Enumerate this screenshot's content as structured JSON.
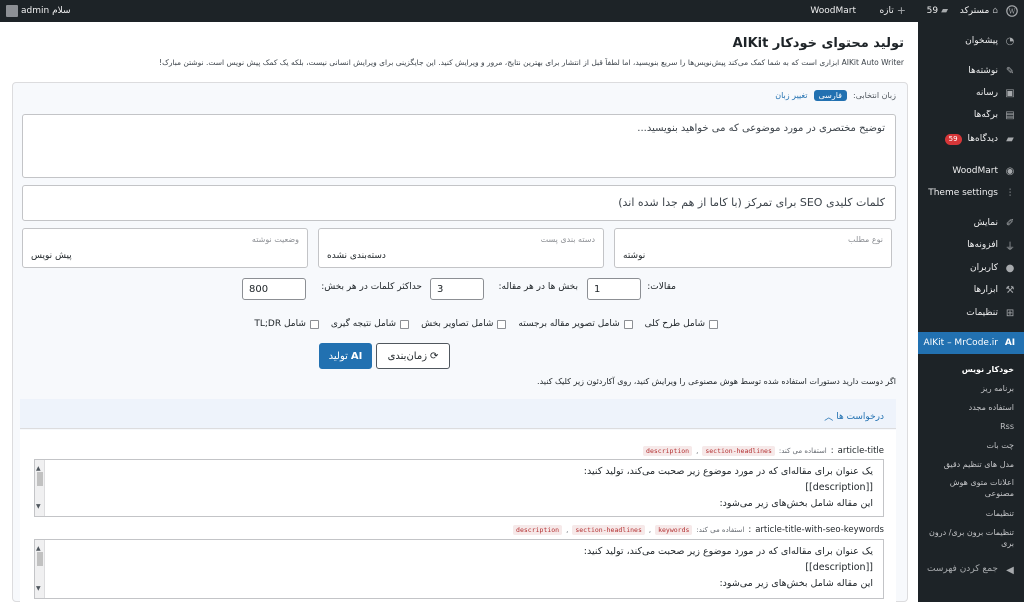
{
  "adminbar": {
    "site_name": "مسترکد",
    "comments_count": "59",
    "new_label": "تازه",
    "woodmart_label": "WoodMart",
    "greeting": "سلام admin"
  },
  "sidebar": {
    "dashboard": "پیشخوان",
    "posts": "نوشته‌ها",
    "media": "رسانه",
    "pages": "برگه‌ها",
    "comments": "دیدگاه‌ها",
    "comments_badge": "59",
    "woodmart": "WoodMart",
    "theme_settings": "Theme settings",
    "appearance": "نمایش",
    "plugins": "افزونه‌ها",
    "users": "کاربران",
    "tools": "ابزارها",
    "settings": "تنظیمات",
    "aikit": "AIKit – MrCode.ir",
    "sub": {
      "auto_writer": "خودکار نویس",
      "scheduler": "برنامه ریز",
      "usage": "استفاده مجدد",
      "rss": "Rss",
      "chat": "چت بات",
      "fine_tune": "مدل های تنظیم دقیق",
      "smart_content": "اعلانات متوی هوش مصنوعی",
      "settings": "تنظیمات",
      "import_export": "تنظیمات برون بری/ درون بری"
    },
    "collapse": "جمع کردن فهرست"
  },
  "main": {
    "title": "تولید محتوای خودکار AIKit",
    "description": "AIKit Auto Writer ابزاری است که به شما کمک می‌کند پیش‌نویس‌ها را سریع بنویسید، اما لطفاً قبل از انتشار برای بهترین نتایج، مرور و ویرایش کنید. این جایگزینی برای ویرایش انسانی نیست، بلکه یک کمک پیش نویس است. نوشتن مبارک!",
    "lang_label": "زبان انتخابی:",
    "lang_value": "فارسی",
    "lang_change": "تغییر زبان",
    "topic_placeholder": "توضیح مختصری در مورد موضوعی که می خواهید بنویسید...",
    "keywords_placeholder": "کلمات کلیدی SEO برای تمرکز (با کاما از هم جدا شده اند)",
    "post_type_label": "نوع مطلب",
    "post_type_value": "نوشته",
    "category_label": "دسته بندی پست",
    "category_value": "دسته‌بندی نشده",
    "status_label": "وضعیت نوشته",
    "status_value": "پیش نویس",
    "articles_label": "مقالات:",
    "articles_value": "1",
    "sections_label": "بخش ها در هر مقاله:",
    "sections_value": "3",
    "max_words_label": "حداکثر کلمات در هر بخش:",
    "max_words_value": "800",
    "checks": [
      "شامل طرح کلی",
      "شامل تصویر مقاله برجسته",
      "شامل تصاویر بخش",
      "شامل نتیجه گیری",
      "شامل TL;DR"
    ],
    "generate_button": "تولید",
    "generate_icon": "AI",
    "schedule_button": "زمان‌بندی",
    "hint": "اگر دوست دارید دستورات استفاده شده توسط هوش مصنوعی را ویرایش کنید، روی آکاردئون زیر کلیک کنید.",
    "requests_title": "درخواست ها",
    "prompt1": {
      "name": "article-title",
      "used_by": "استفاده می کند:",
      "tags": [
        "section-headlines",
        "description"
      ],
      "line1": "یک عنوان برای مقاله‌ای که در مورد موضوع زیر صحبت می‌کند، تولید کنید:",
      "line2": "[[description]]",
      "line3": "این مقاله شامل بخش‌های زیر می‌شود:"
    },
    "prompt2": {
      "name": "article-title-with-seo-keywords",
      "used_by": "استفاده می کند:",
      "tags": [
        "keywords",
        "section-headlines",
        "description"
      ],
      "line1": "یک عنوان برای مقاله‌ای که در مورد موضوع زیر صحبت می‌کند، تولید کنید:",
      "line2": "[[description]]",
      "line3": "این مقاله شامل بخش‌های زیر می‌شود:"
    }
  }
}
